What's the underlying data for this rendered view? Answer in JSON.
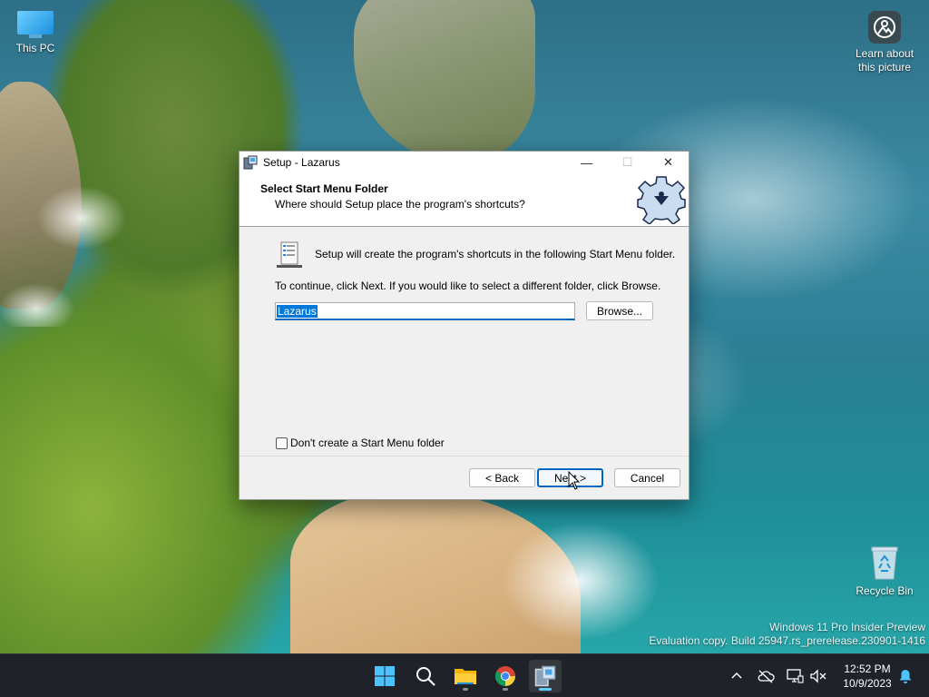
{
  "desktop": {
    "icons": [
      {
        "label": "This PC"
      },
      {
        "label": "Learn about this picture"
      },
      {
        "label": "Recycle Bin"
      }
    ],
    "watermark": {
      "line1": "Windows 11 Pro Insider Preview",
      "line2": "Evaluation copy. Build 25947.rs_prerelease.230901-1416"
    }
  },
  "dialog": {
    "title": "Setup - Lazarus",
    "window_buttons": {
      "minimize": "—",
      "maximize": "☐",
      "close": "✕"
    },
    "header": {
      "title": "Select Start Menu Folder",
      "subtitle": "Where should Setup place the program's shortcuts?"
    },
    "body": {
      "intro": "Setup will create the program's shortcuts in the following Start Menu folder.",
      "instruction": "To continue, click Next. If you would like to select a different folder, click Browse.",
      "folder_value": "Lazarus",
      "browse_label": "Browse...",
      "no_folder_checkbox_label": "Don't create a Start Menu folder",
      "no_folder_checked": false
    },
    "buttons": {
      "back": "< Back",
      "next": "Next >",
      "cancel": "Cancel"
    }
  },
  "taskbar": {
    "apps": [
      {
        "name": "start-icon"
      },
      {
        "name": "search-icon"
      },
      {
        "name": "file-explorer-icon"
      },
      {
        "name": "chrome-icon"
      },
      {
        "name": "setup-icon",
        "active": true
      }
    ],
    "tray": {
      "time": "12:52 PM",
      "date": "10/9/2023"
    }
  },
  "colors": {
    "accent": "#0067c0",
    "selection": "#0078d7",
    "taskbar": "#1f2329"
  }
}
